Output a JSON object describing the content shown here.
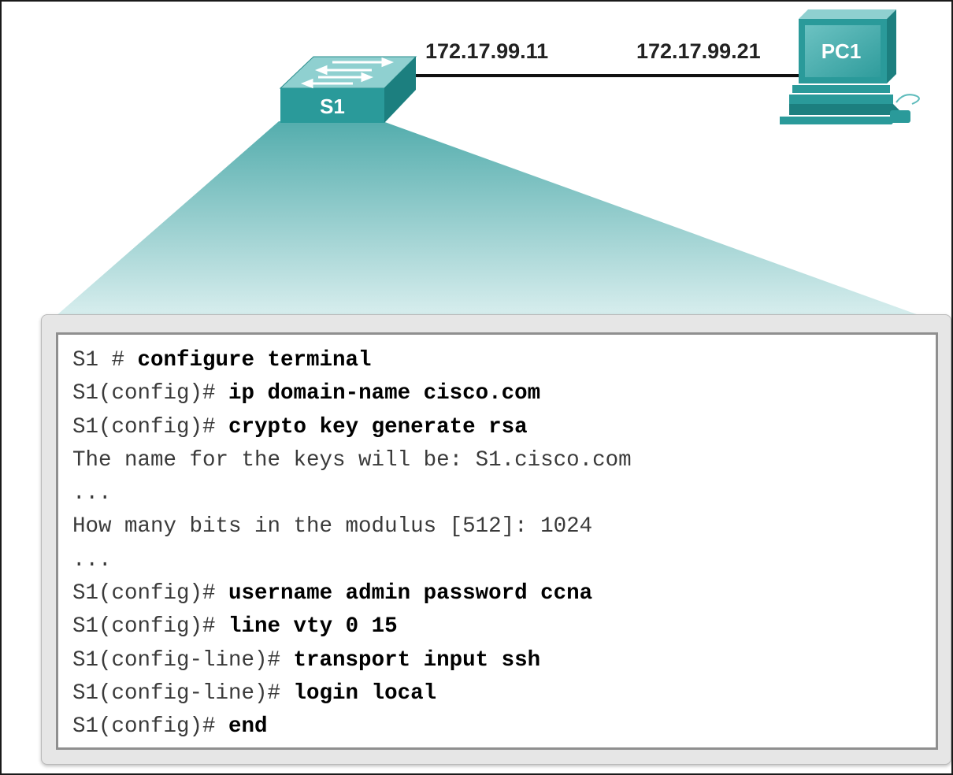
{
  "devices": {
    "switch": {
      "label": "S1"
    },
    "pc": {
      "label": "PC1"
    }
  },
  "link": {
    "switch_ip": "172.17.99.11",
    "pc_ip": "172.17.99.21"
  },
  "colors": {
    "teal": "#2a9a9a",
    "teal_dark": "#1c7f7f",
    "teal_light": "#5fbcbc",
    "fan_top": "#5fb3b3",
    "fan_bottom": "#d5ecec"
  },
  "terminal": {
    "lines": [
      {
        "prompt": "S1 # ",
        "cmd": "configure terminal"
      },
      {
        "prompt": "S1(config)# ",
        "cmd": "ip domain-name cisco.com"
      },
      {
        "prompt": "S1(config)# ",
        "cmd": "crypto key generate rsa"
      },
      {
        "output": "The name for the keys will be: S1.cisco.com"
      },
      {
        "output": "..."
      },
      {
        "output": "How many bits in the modulus [512]: 1024"
      },
      {
        "output": "..."
      },
      {
        "prompt": "S1(config)# ",
        "cmd": "username admin password ccna"
      },
      {
        "prompt": "S1(config)# ",
        "cmd": "line vty 0 15"
      },
      {
        "prompt": "S1(config-line)# ",
        "cmd": "transport input ssh"
      },
      {
        "prompt": "S1(config-line)# ",
        "cmd": "login local"
      },
      {
        "prompt": "S1(config)# ",
        "cmd": "end"
      }
    ]
  }
}
